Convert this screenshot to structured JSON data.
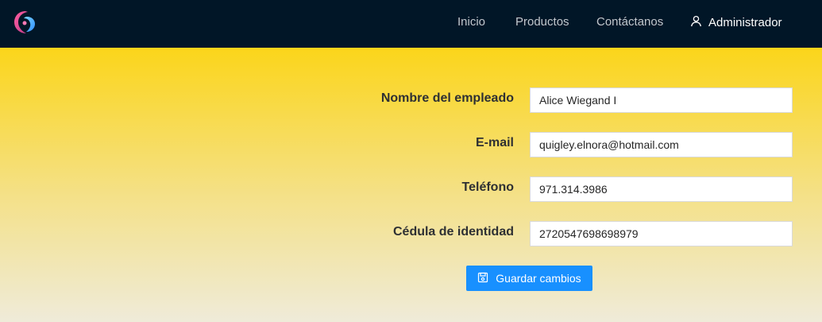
{
  "navbar": {
    "logo_icon": "swirl-logo-icon",
    "links": {
      "inicio": "Inicio",
      "productos": "Productos",
      "contacto": "Contáctanos"
    },
    "user": {
      "icon": "user-icon",
      "label": "Administrador"
    }
  },
  "form": {
    "nombre": {
      "label": "Nombre del empleado",
      "value": "Alice Wiegand I"
    },
    "email": {
      "label": "E-mail",
      "value": "quigley.elnora@hotmail.com"
    },
    "telefono": {
      "label": "Teléfono",
      "value": "971.314.3986"
    },
    "cedula": {
      "label": "Cédula de identidad",
      "value": "2720547698698979"
    },
    "save": {
      "icon": "save-icon",
      "label": "Guardar cambios"
    }
  },
  "colors": {
    "navbar_bg": "#011627",
    "gradient_top": "#fbd51a",
    "gradient_bottom": "#efebd9",
    "primary_button": "#1890ff"
  }
}
